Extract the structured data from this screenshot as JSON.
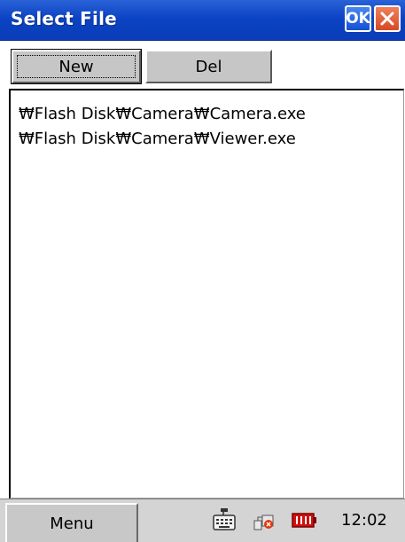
{
  "window": {
    "title": "Select File",
    "ok_label": "OK",
    "close_icon": "close-icon"
  },
  "toolbar": {
    "new_label": "New",
    "del_label": "Del"
  },
  "file_list": {
    "items": [
      "₩Flash Disk₩Camera₩Camera.exe",
      "₩Flash Disk₩Camera₩Viewer.exe"
    ]
  },
  "taskbar": {
    "menu_label": "Menu",
    "tray_icons": [
      "keyboard-icon",
      "network-icon",
      "battery-icon"
    ],
    "clock": "12:02"
  },
  "colors": {
    "titlebar": "#0b43c4",
    "close_button": "#d64a24",
    "battery": "#d01010"
  }
}
